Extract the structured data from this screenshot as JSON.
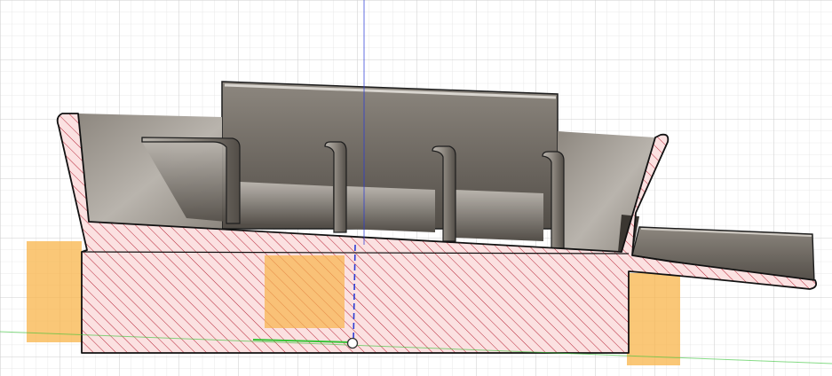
{
  "viewport": {
    "background": "#ffffff",
    "grid_minor_color": "#e3e3e3",
    "grid_major_color": "#cfcfcf"
  },
  "axes": {
    "vertical_axis_color": "#2b3bd6",
    "horizontal_axis_color": "#36c436"
  },
  "section": {
    "fill_color": "#fbe1e1",
    "hatch_color": "#b8283a",
    "outline_color": "#111111"
  },
  "highlight": {
    "color": "#f8b44a"
  },
  "body": {
    "surface_light": "#b9b4ad",
    "surface_mid": "#8d877f",
    "surface_dark": "#524d47",
    "edge_color": "#1e1e1e"
  },
  "icons": {
    "origin": "origin-point-icon"
  }
}
